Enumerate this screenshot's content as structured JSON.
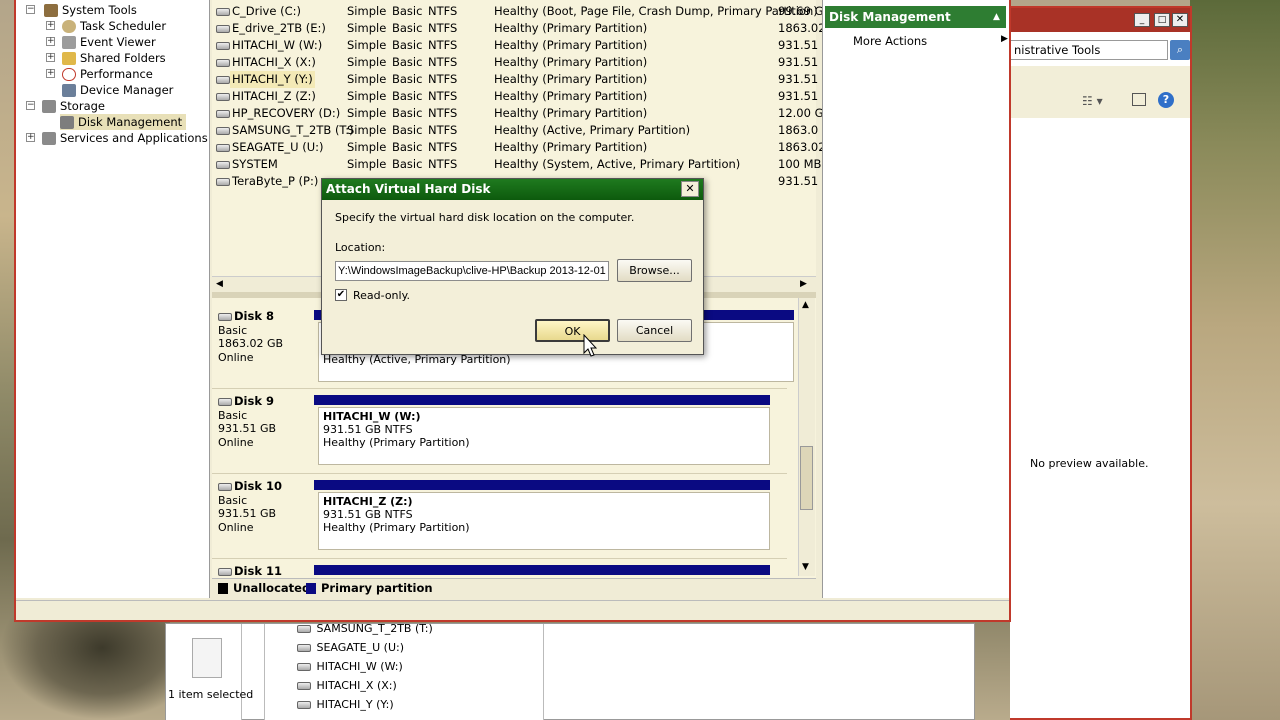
{
  "tree": {
    "items": [
      {
        "label": "System Tools"
      },
      {
        "label": "Task Scheduler"
      },
      {
        "label": "Event Viewer"
      },
      {
        "label": "Shared Folders"
      },
      {
        "label": "Performance"
      },
      {
        "label": "Device Manager"
      },
      {
        "label": "Storage"
      },
      {
        "label": "Disk Management"
      },
      {
        "label": "Services and Applications"
      }
    ]
  },
  "volumes": [
    {
      "name": "C_Drive (C:)",
      "layout": "Simple",
      "type": "Basic",
      "fs": "NTFS",
      "status": "Healthy (Boot, Page File, Crash Dump, Primary Partition)",
      "capacity": "99.69 G"
    },
    {
      "name": "E_drive_2TB (E:)",
      "layout": "Simple",
      "type": "Basic",
      "fs": "NTFS",
      "status": "Healthy (Primary Partition)",
      "capacity": "1863.02"
    },
    {
      "name": "HITACHI_W (W:)",
      "layout": "Simple",
      "type": "Basic",
      "fs": "NTFS",
      "status": "Healthy (Primary Partition)",
      "capacity": "931.51"
    },
    {
      "name": "HITACHI_X (X:)",
      "layout": "Simple",
      "type": "Basic",
      "fs": "NTFS",
      "status": "Healthy (Primary Partition)",
      "capacity": "931.51"
    },
    {
      "name": "HITACHI_Y (Y:)",
      "layout": "Simple",
      "type": "Basic",
      "fs": "NTFS",
      "status": "Healthy (Primary Partition)",
      "capacity": "931.51"
    },
    {
      "name": "HITACHI_Z (Z:)",
      "layout": "Simple",
      "type": "Basic",
      "fs": "NTFS",
      "status": "Healthy (Primary Partition)",
      "capacity": "931.51"
    },
    {
      "name": "HP_RECOVERY (D:)",
      "layout": "Simple",
      "type": "Basic",
      "fs": "NTFS",
      "status": "Healthy (Primary Partition)",
      "capacity": "12.00 G"
    },
    {
      "name": "SAMSUNG_T_2TB (T:)",
      "layout": "Simple",
      "type": "Basic",
      "fs": "NTFS",
      "status": "Healthy (Active, Primary Partition)",
      "capacity": "1863.0"
    },
    {
      "name": "SEAGATE_U (U:)",
      "layout": "Simple",
      "type": "Basic",
      "fs": "NTFS",
      "status": "Healthy (Primary Partition)",
      "capacity": "1863.02"
    },
    {
      "name": "SYSTEM",
      "layout": "Simple",
      "type": "Basic",
      "fs": "NTFS",
      "status": "Healthy (System, Active, Primary Partition)",
      "capacity": "100 MB"
    },
    {
      "name": "TeraByte_P (P:)",
      "layout": "",
      "type": "",
      "fs": "",
      "status": "",
      "capacity": "931.51"
    }
  ],
  "disks": [
    {
      "name": "Disk 8",
      "type": "Basic",
      "size": "1863.02 GB",
      "state": "Online",
      "part_name": "",
      "part_size": "",
      "part_status": "Healthy (Active, Primary Partition)"
    },
    {
      "name": "Disk 9",
      "type": "Basic",
      "size": "931.51 GB",
      "state": "Online",
      "part_name": "HITACHI_W  (W:)",
      "part_size": "931.51 GB NTFS",
      "part_status": "Healthy (Primary Partition)"
    },
    {
      "name": "Disk 10",
      "type": "Basic",
      "size": "931.51 GB",
      "state": "Online",
      "part_name": "HITACHI_Z  (Z:)",
      "part_size": "931.51 GB NTFS",
      "part_status": "Healthy (Primary Partition)"
    },
    {
      "name": "Disk 11"
    }
  ],
  "legend": {
    "unallocated": "Unallocated",
    "primary": "Primary partition"
  },
  "actions": {
    "header": "Disk Management",
    "more": "More Actions"
  },
  "win2": {
    "address": "nistrative Tools",
    "preview": "No preview available."
  },
  "explorer": {
    "selected": "1 item selected",
    "items": [
      "SAMSUNG_T_2TB (T:)",
      "SEAGATE_U (U:)",
      "HITACHI_W (W:)",
      "HITACHI_X (X:)",
      "HITACHI_Y (Y:)"
    ]
  },
  "dialog": {
    "title": "Attach Virtual Hard Disk",
    "instruction": "Specify the virtual hard disk location on the computer.",
    "location_label": "Location:",
    "location_value": "Y:\\WindowsImageBackup\\clive-HP\\Backup 2013-12-01",
    "browse": "Browse...",
    "readonly": "Read-only.",
    "ok": "OK",
    "cancel": "Cancel"
  },
  "colors": {
    "accent_green": "#2e7d32",
    "partition_blue": "#0a0a82",
    "window_border_red": "#c0392b"
  }
}
